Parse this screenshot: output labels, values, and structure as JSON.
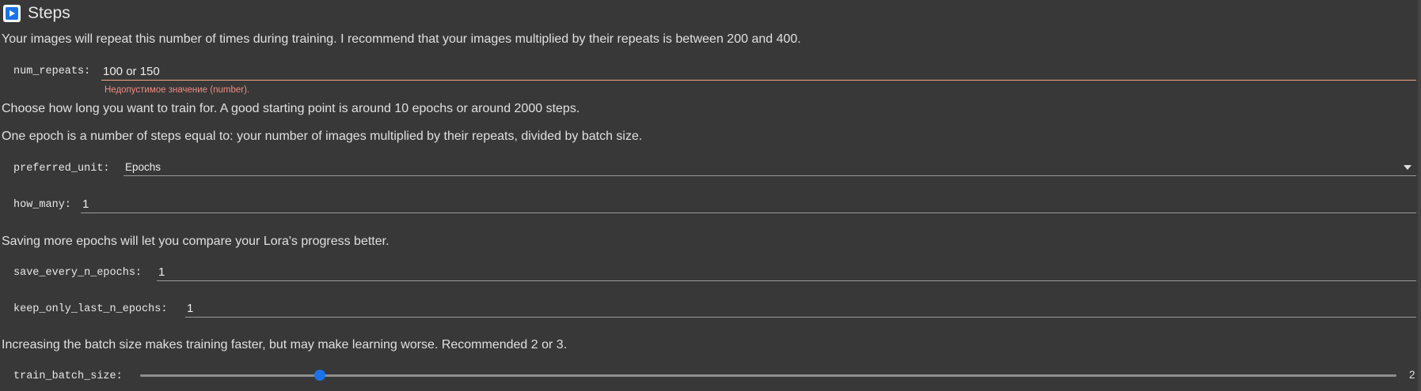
{
  "header": {
    "title": "Steps",
    "icon": "play-icon",
    "icon_color": "#1a73e8"
  },
  "text": {
    "repeats_desc": "Your images will repeat this number of times during training. I recommend that your images multiplied by their repeats is between 200 and 400.",
    "train_length_desc": "Choose how long you want to train for. A good starting point is around 10 epochs or around 2000 steps.",
    "epoch_desc": "One epoch is a number of steps equal to: your number of images multiplied by their repeats, divided by batch size.",
    "save_desc": "Saving more epochs will let you compare your Lora's progress better.",
    "batch_desc": "Increasing the batch size makes training faster, but may make learning worse. Recommended 2 or 3."
  },
  "fields": {
    "num_repeats": {
      "label": "num_repeats:",
      "value": "100 or 150",
      "error": "Недопустимое значение (number).",
      "error_color": "#f28b82"
    },
    "preferred_unit": {
      "label": "preferred_unit:",
      "value": "Epochs"
    },
    "how_many": {
      "label": "how_many:",
      "value": "1"
    },
    "save_every_n_epochs": {
      "label": "save_every_n_epochs:",
      "value": "1"
    },
    "keep_only_last_n_epochs": {
      "label": "keep_only_last_n_epochs:",
      "value": "1"
    },
    "train_batch_size": {
      "label": "train_batch_size:",
      "value": "2",
      "min": 1,
      "max": 8
    }
  }
}
